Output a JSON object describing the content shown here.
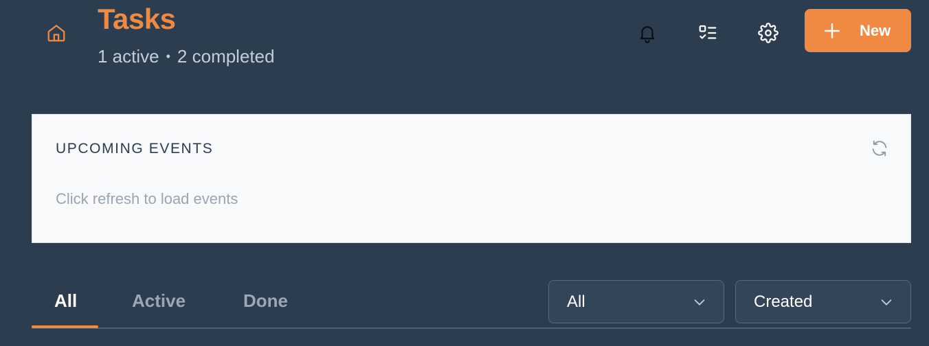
{
  "header": {
    "title": "Tasks",
    "subtitle": {
      "active": "1 active",
      "separator": "•",
      "completed": "2 completed"
    },
    "new_button_label": "New",
    "icons": {
      "home": "home-icon",
      "bell": "bell-icon",
      "tasks": "task-list-icon",
      "settings": "gear-icon",
      "plus": "plus-icon"
    }
  },
  "events": {
    "title": "UPCOMING EVENTS",
    "empty_message": "Click refresh to load events",
    "refresh_icon": "refresh-icon"
  },
  "tabs": [
    {
      "label": "All",
      "active": true
    },
    {
      "label": "Active",
      "active": false
    },
    {
      "label": "Done",
      "active": false
    }
  ],
  "filters": {
    "filter_select": {
      "selected": "All"
    },
    "sort_select": {
      "selected": "Created"
    }
  },
  "colors": {
    "background": "#2c3d4f",
    "accent": "#f08a43",
    "card": "#f8f9fb"
  }
}
